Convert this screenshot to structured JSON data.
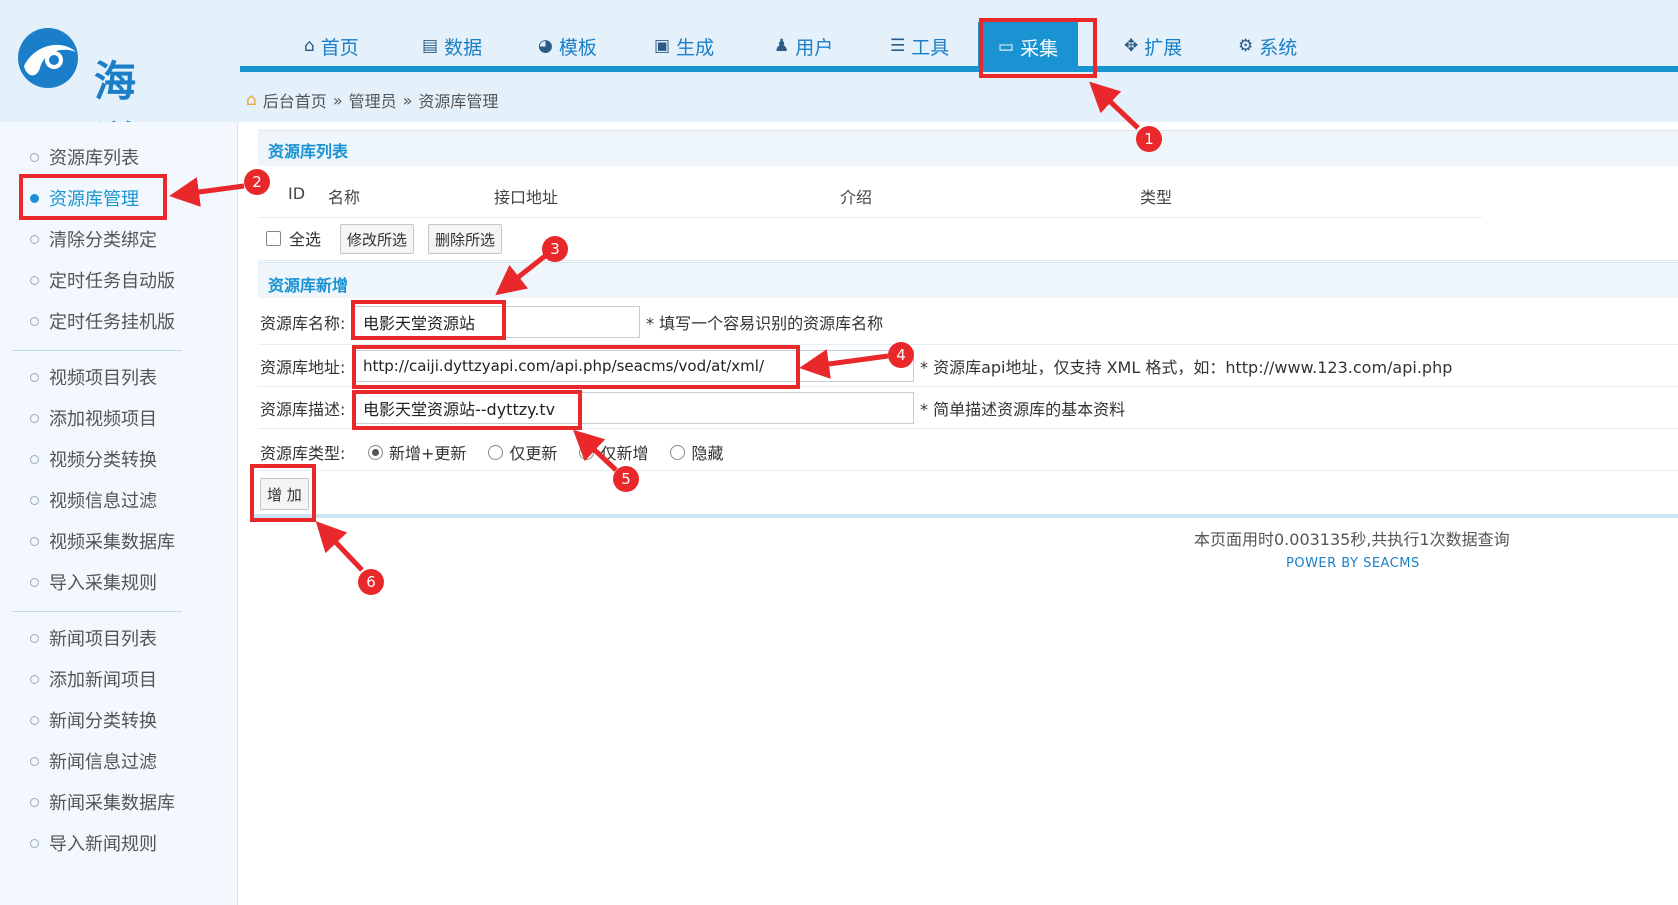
{
  "logo": {
    "text": "海洋"
  },
  "nav": {
    "items": [
      {
        "label": "首页",
        "icon": "home-icon"
      },
      {
        "label": "数据",
        "icon": "data-icon"
      },
      {
        "label": "模板",
        "icon": "palette-icon"
      },
      {
        "label": "生成",
        "icon": "generate-icon"
      },
      {
        "label": "用户",
        "icon": "user-icon"
      },
      {
        "label": "工具",
        "icon": "tools-icon"
      },
      {
        "label": "采集",
        "icon": "monitor-icon"
      },
      {
        "label": "扩展",
        "icon": "extend-icon"
      },
      {
        "label": "系统",
        "icon": "gear-icon"
      }
    ],
    "active": "采集"
  },
  "breadcrumb": {
    "home": "后台首页",
    "sep1": "»",
    "level2": "管理员",
    "sep2": "»",
    "current": "资源库管理"
  },
  "sidebar": {
    "groups": [
      [
        "资源库列表",
        "资源库管理",
        "清除分类绑定",
        "定时任务自动版",
        "定时任务挂机版"
      ],
      [
        "视频项目列表",
        "添加视频项目",
        "视频分类转换",
        "视频信息过滤",
        "视频采集数据库",
        "导入采集规则"
      ],
      [
        "新闻项目列表",
        "添加新闻项目",
        "新闻分类转换",
        "新闻信息过滤",
        "新闻采集数据库",
        "导入新闻规则"
      ]
    ],
    "active": "资源库管理"
  },
  "list_section": {
    "title": "资源库列表",
    "columns": [
      "ID",
      "名称",
      "接口地址",
      "介绍",
      "类型"
    ],
    "select_all": "全选",
    "edit_selected": "修改所选",
    "delete_selected": "删除所选"
  },
  "form_section": {
    "title": "资源库新增",
    "name_label": "资源库名称:",
    "name_value": "电影天堂资源站",
    "name_hint": "* 填写一个容易识别的资源库名称",
    "url_label": "资源库地址:",
    "url_value": "http://caiji.dyttzyapi.com/api.php/seacms/vod/at/xml/",
    "url_hint": "* 资源库api地址，仅支持 XML 格式，如：http://www.123.com/api.php",
    "desc_label": "资源库描述:",
    "desc_value": "电影天堂资源站--dyttzy.tv",
    "desc_hint": "* 简单描述资源库的基本资料",
    "type_label": "资源库类型:",
    "type_options": [
      "新增+更新",
      "仅更新",
      "仅新增",
      "隐藏"
    ],
    "type_selected": "新增+更新",
    "submit": "增 加"
  },
  "footer": {
    "timing": "本页面用时0.003135秒,共执行1次数据查询",
    "power": "POWER BY SEACMS"
  },
  "annotations": [
    "1",
    "2",
    "3",
    "4",
    "5",
    "6"
  ],
  "colors": {
    "accent": "#1a93d2",
    "annotation": "#e8282b",
    "header_bg": "#e4f1fb"
  }
}
